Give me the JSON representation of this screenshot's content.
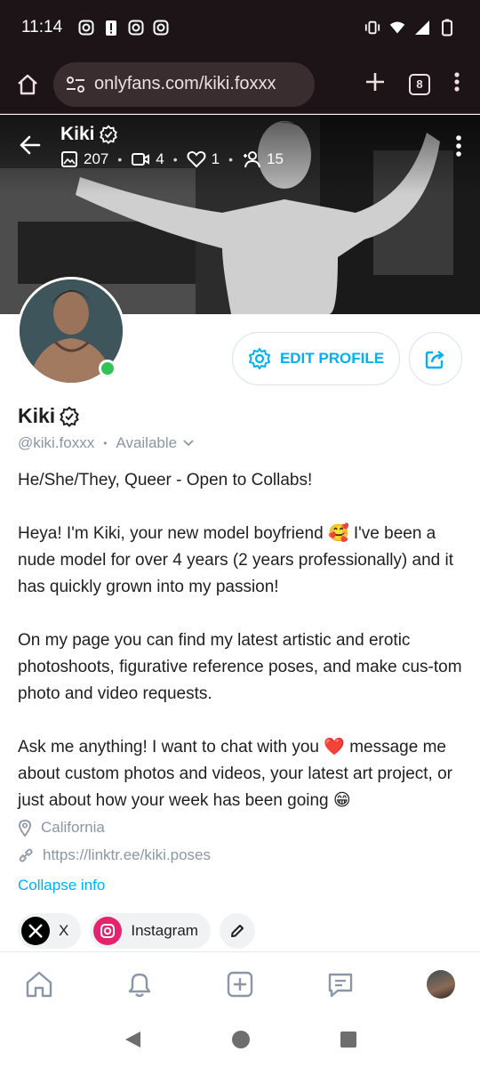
{
  "status_bar": {
    "time": "11:14",
    "notification_icons": [
      "instagram-icon",
      "battery-alert-icon",
      "instagram-icon",
      "instagram-icon"
    ],
    "system_icons": [
      "vibrate-icon",
      "wifi-icon",
      "signal-icon",
      "battery-icon"
    ]
  },
  "browser": {
    "url": "onlyfans.com/kiki.foxxx",
    "tab_count": "8"
  },
  "cover": {
    "name": "Kiki",
    "stats": {
      "photos": "207",
      "videos": "4",
      "likes": "1",
      "fans": "15"
    }
  },
  "profile": {
    "edit_label": "EDIT PROFILE",
    "name": "Kiki",
    "handle": "@kiki.foxxx",
    "availability": "Available",
    "bio": {
      "line1": "He/She/They, Queer - Open to Collabs!",
      "para2": "Heya! I'm Kiki, your new model boyfriend 🥰 I've been a nude model for over 4 years (2 years professionally) and it has quickly grown into my passion!",
      "para3": "On my page you can find my latest artistic and erotic photoshoots, figurative reference poses, and make cus-tom photo and video requests.",
      "para4": "Ask me anything! I want to chat with you ❤️ message me about custom photos and videos, your latest art project, or just about how your week has been going 😁"
    },
    "location": "California",
    "link": "https://linktr.ee/kiki.poses",
    "collapse_label": "Collapse info",
    "socials": [
      {
        "label": "X"
      },
      {
        "label": "Instagram"
      }
    ]
  },
  "colors": {
    "accent": "#00aff0",
    "online": "#2fc453",
    "chrome_bg": "#1c1416",
    "muted_text": "#8a96a3"
  }
}
